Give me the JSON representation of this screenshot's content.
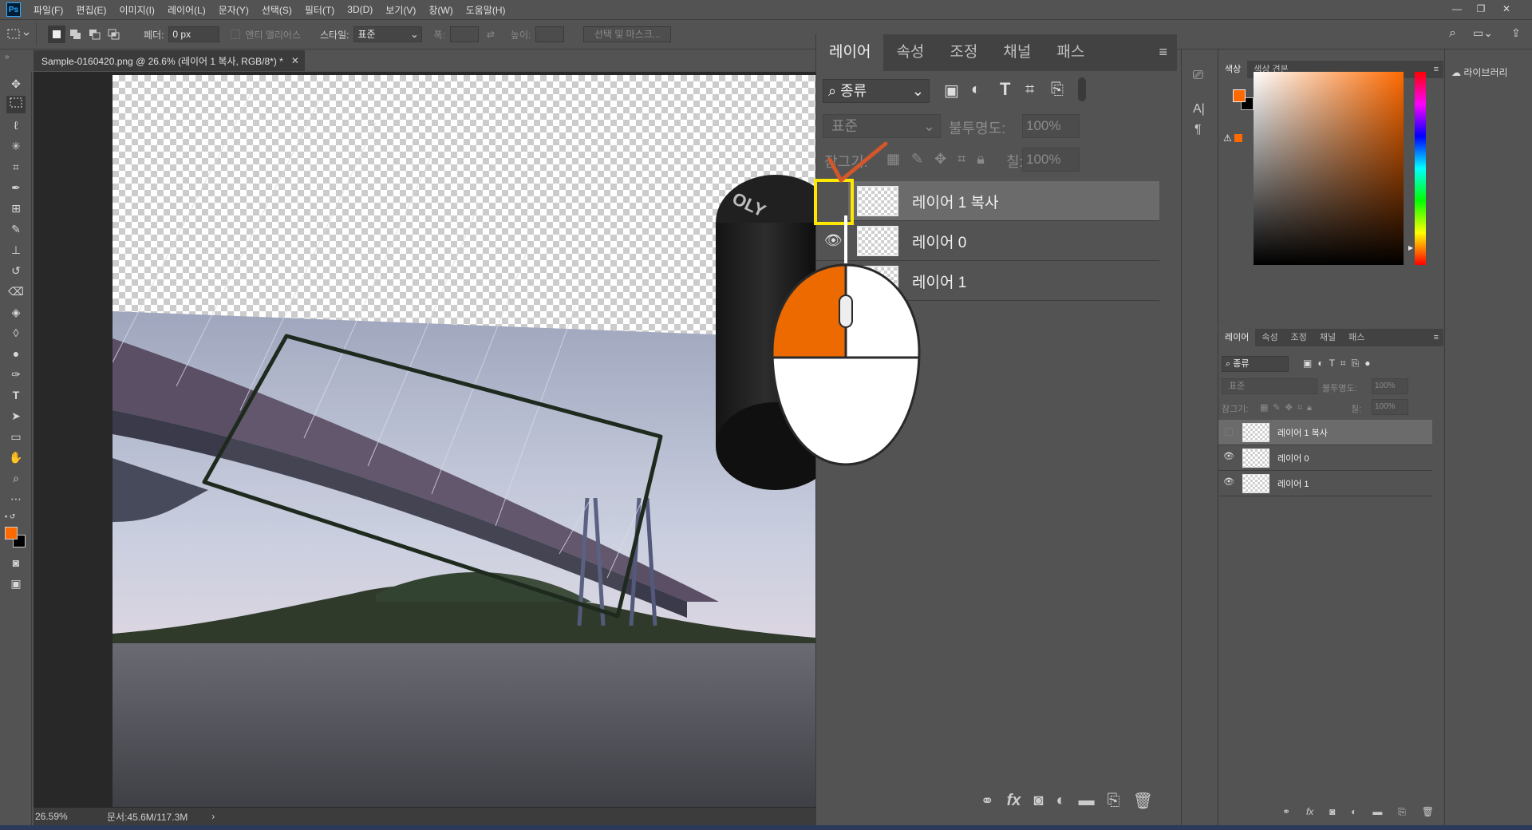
{
  "app": {
    "logo": "Ps"
  },
  "menu": [
    "파일(F)",
    "편집(E)",
    "이미지(I)",
    "레이어(L)",
    "문자(Y)",
    "선택(S)",
    "필터(T)",
    "3D(D)",
    "보기(V)",
    "창(W)",
    "도움말(H)"
  ],
  "options": {
    "feather_label": "페더:",
    "feather_value": "0 px",
    "antialias_label": "앤티 앨리어스",
    "style_label": "스타일:",
    "style_value": "표준",
    "width_label": "폭:",
    "height_label": "높이:",
    "select_mask_button": "선택 및 마스크..."
  },
  "document": {
    "tab_title": "Sample-0160420.png @ 26.6% (레이어 1 복사, RGB/8*) *",
    "zoom": "26.59%",
    "doc_size": "문서:45.6M/117.3M"
  },
  "big_layers_panel": {
    "tabs": [
      "레이어",
      "속성",
      "조정",
      "채널",
      "패스"
    ],
    "active_tab": "레이어",
    "filter_label": "종류",
    "blend_mode": "표준",
    "opacity_label": "불투명도:",
    "opacity_value": "100%",
    "lock_label": "잠그기:",
    "fill_label": "칠:",
    "fill_value": "100%",
    "layers": [
      {
        "name": "레이어 1 복사",
        "visible": false,
        "selected": true
      },
      {
        "name": "레이어 0",
        "visible": true,
        "selected": false
      },
      {
        "name": "레이어 1",
        "visible": true,
        "selected": false
      }
    ]
  },
  "color_panel": {
    "tabs": [
      "색상",
      "색상 견본"
    ],
    "active_tab": "색상",
    "foreground_color": "#ff6a00",
    "background_color": "#000000"
  },
  "small_layers_panel": {
    "tabs": [
      "레이어",
      "속성",
      "조정",
      "채널",
      "패스"
    ],
    "active_tab": "레이어",
    "filter_label": "종류",
    "blend_mode": "표준",
    "opacity_label": "불투명도:",
    "opacity_value": "100%",
    "lock_label": "잠그기:",
    "fill_label": "칠:",
    "fill_value": "100%",
    "layers": [
      {
        "name": "레이어 1 복사",
        "visible": false,
        "selected": true
      },
      {
        "name": "레이어 0",
        "visible": true,
        "selected": false
      },
      {
        "name": "레이어 1",
        "visible": true,
        "selected": false
      }
    ]
  },
  "libraries": {
    "label": "라이브러리"
  },
  "annotation": {
    "highlight_color": "#ffe800",
    "mouse_accent_color": "#ec6a00"
  }
}
